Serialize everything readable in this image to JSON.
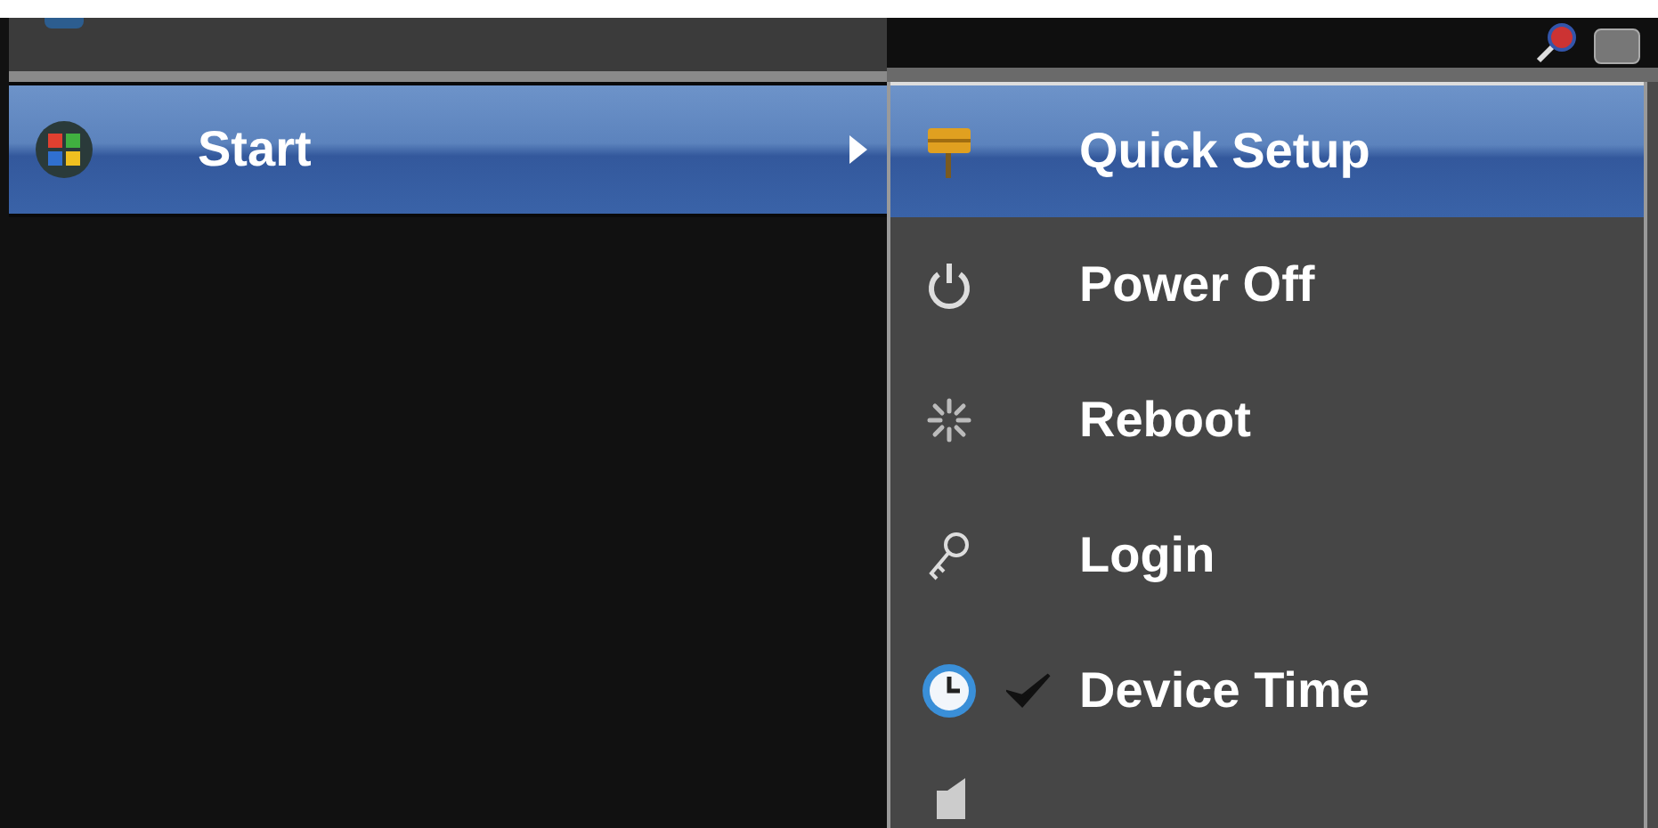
{
  "main_menu": [
    {
      "label": "Start",
      "selected": true,
      "has_submenu": true
    }
  ],
  "submenu": [
    {
      "kind": "setup",
      "label": "Quick Setup",
      "selected": true,
      "checked": false
    },
    {
      "kind": "power",
      "label": "Power Off",
      "selected": false,
      "checked": false
    },
    {
      "kind": "reboot",
      "label": "Reboot",
      "selected": false,
      "checked": false
    },
    {
      "kind": "login",
      "label": "Login",
      "selected": false,
      "checked": false
    },
    {
      "kind": "clock",
      "label": "Device Time",
      "selected": false,
      "checked": true
    }
  ]
}
